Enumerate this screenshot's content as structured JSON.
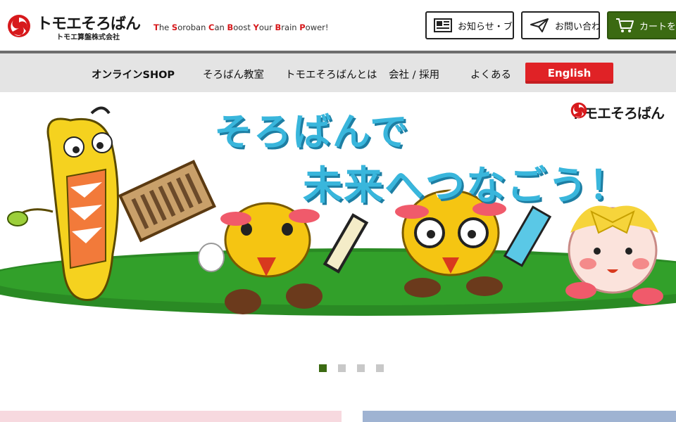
{
  "header": {
    "logo_text": "トモエそろばん",
    "logo_sub": "トモエ算盤株式会社",
    "tagline": "The Soroban Can Boost Your Brain Power!",
    "tagline_highlight": "T S C B Y B P",
    "buttons": {
      "news": "お知らせ・ブログ",
      "contact": "お問い合わせ",
      "cart": "カートを見る"
    },
    "cart_color": "#3b6a12"
  },
  "nav": {
    "items": [
      "オンラインSHOP",
      "そろばん教室",
      "トモエそろばんとは",
      "会社 / 採用",
      "よくある"
    ],
    "english": "English",
    "english_color": "#e02226"
  },
  "hero": {
    "line1": "そろばんで",
    "line2": "未来へつなごう！",
    "brand": "トモエそろばん"
  },
  "carousel": {
    "slide_count": 4,
    "active_index": 0
  }
}
